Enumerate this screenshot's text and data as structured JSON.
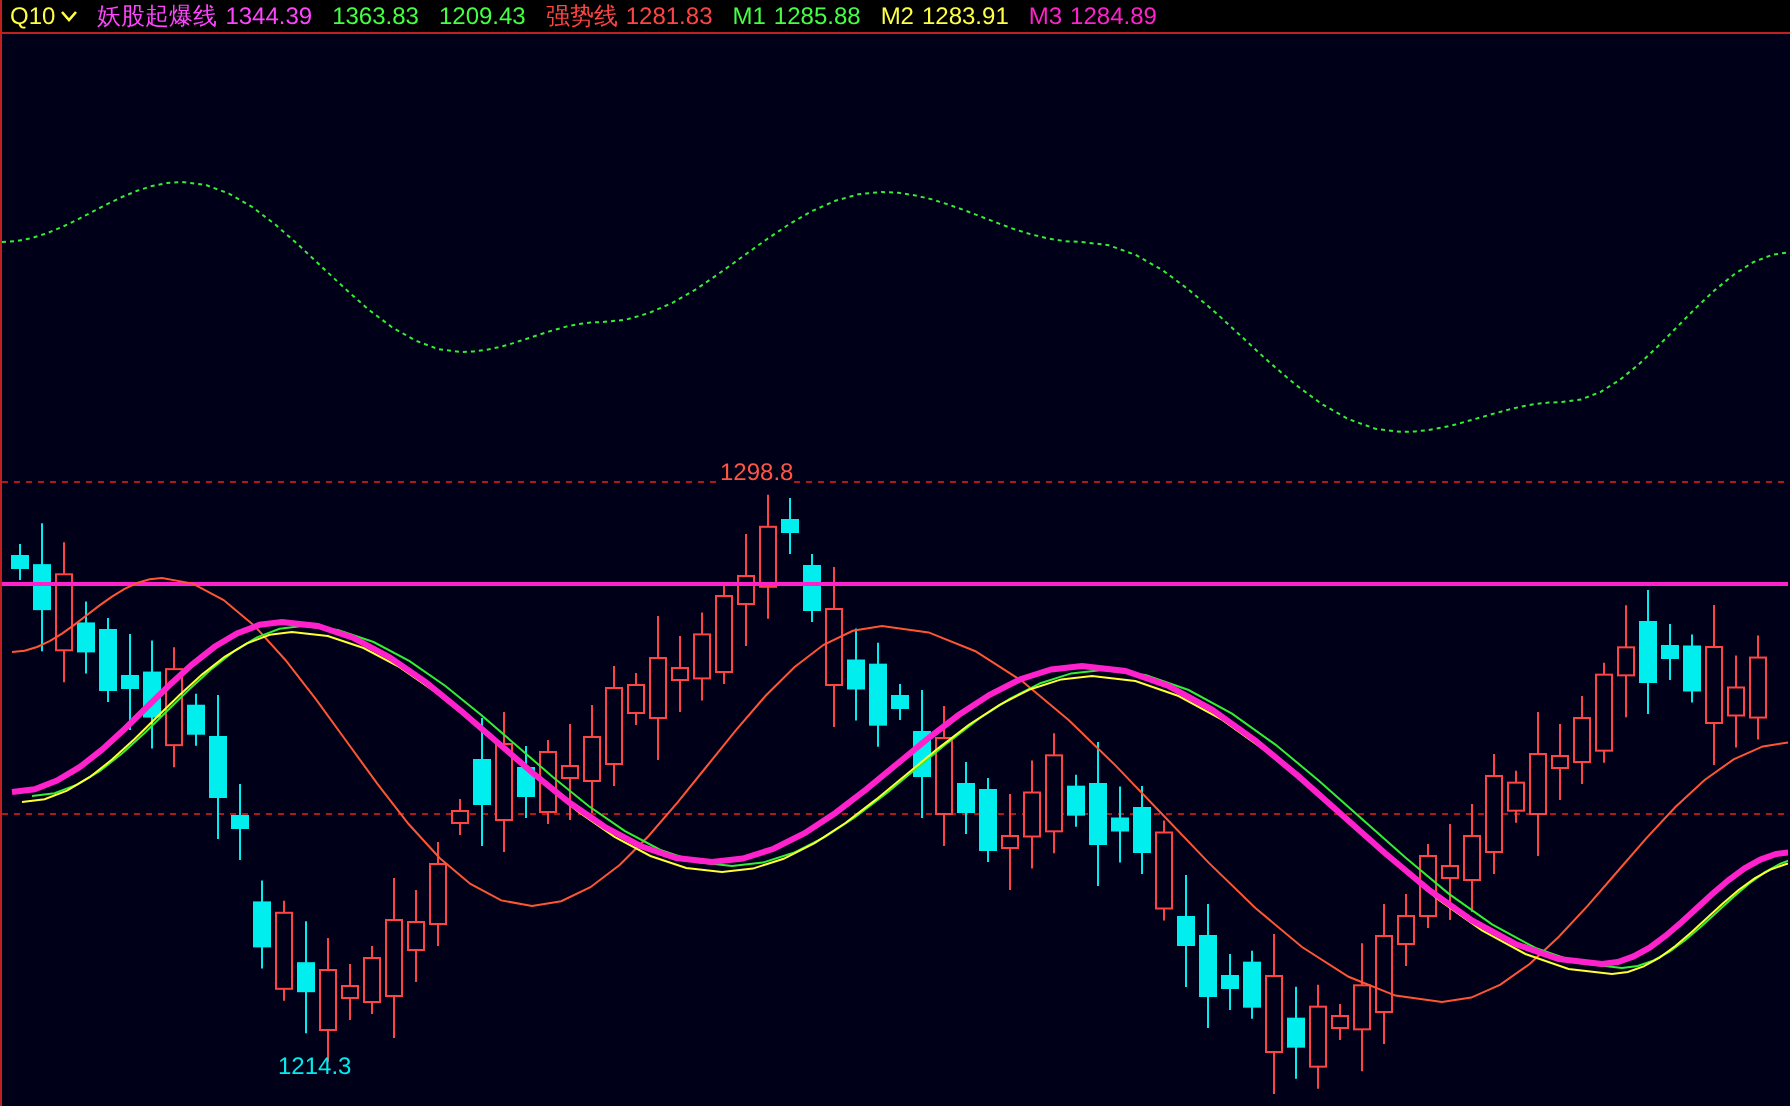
{
  "header": {
    "symbol": "Q10",
    "series": [
      {
        "label": "妖股起爆线",
        "value": "1344.39",
        "color": "#ff44ff"
      },
      {
        "value": "1363.83",
        "color": "#44ff44"
      },
      {
        "value": "1209.43",
        "color": "#44ff44"
      },
      {
        "label": "强势线",
        "value": "1281.83",
        "color": "#ff4444"
      },
      {
        "label": "M1",
        "value": "1285.88",
        "color": "#44ff44"
      },
      {
        "label": "M2",
        "value": "1283.91",
        "color": "#ffff44"
      },
      {
        "label": "M3",
        "value": "1284.89",
        "color": "#ff22cc"
      }
    ]
  },
  "chart": {
    "high_label": "1298.8",
    "low_label": "1214.3"
  }
}
